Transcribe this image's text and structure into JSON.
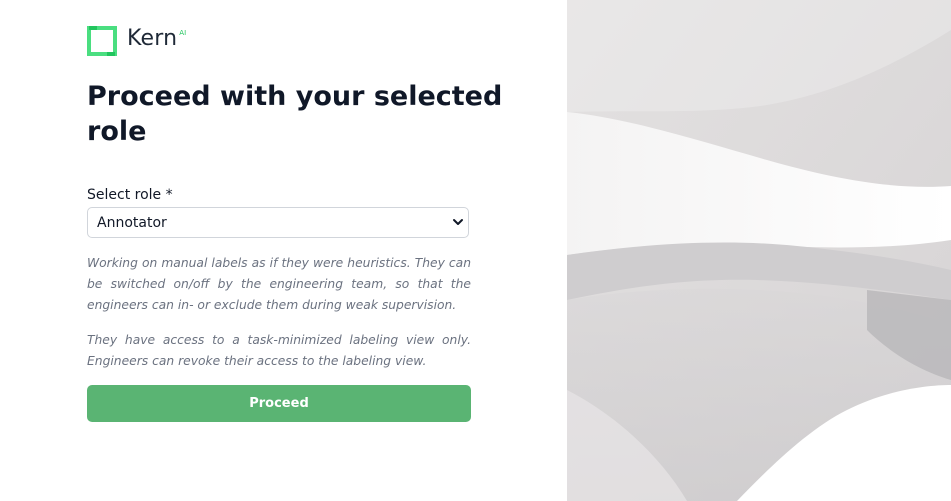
{
  "brand": {
    "name": "Kern",
    "suffix": "AI",
    "accent_color": "#22c55e",
    "logo_icon": "square-bracket-logo-icon"
  },
  "heading": "Proceed with your selected role",
  "role_field": {
    "label": "Select role *",
    "selected_value": "Annotator",
    "icon": "chevron-down-icon"
  },
  "description": {
    "paragraph_1": "Working on manual labels as if they were heuristics. They can be switched on/off by the engineering team, so that the engineers can in- or exclude them during weak supervision.",
    "paragraph_2": "They have access to a task-minimized labeling view only. Engineers can revoke their access to the labeling view."
  },
  "proceed_button": {
    "label": "Proceed",
    "color": "#5ab473"
  }
}
